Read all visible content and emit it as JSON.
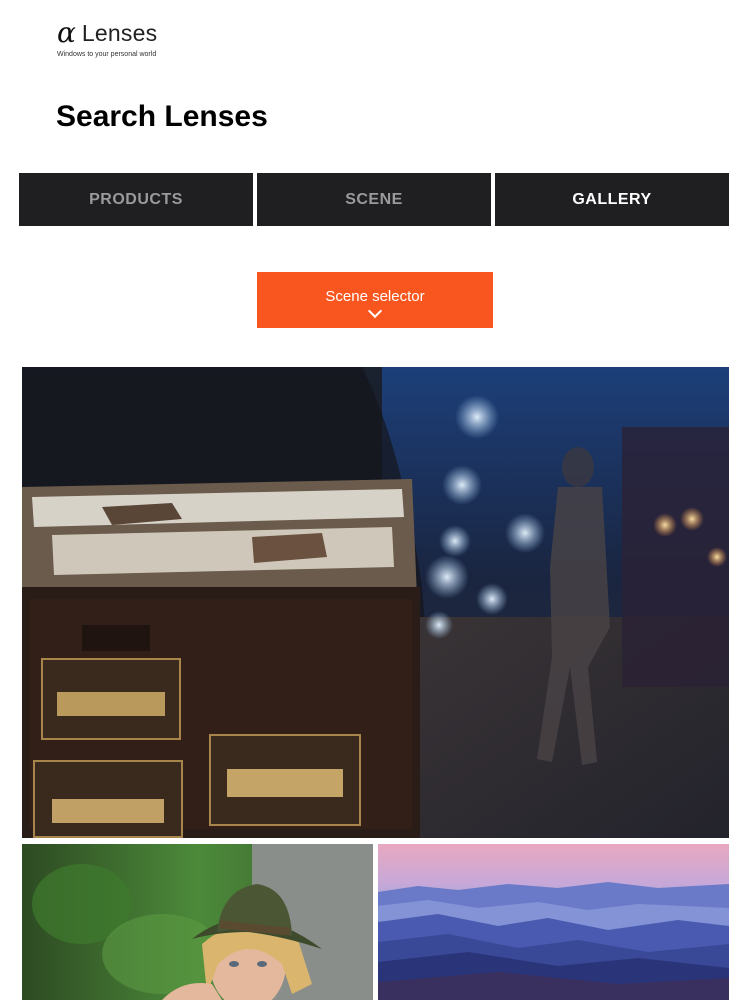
{
  "brand": {
    "logo_symbol": "α",
    "logo_text": "Lenses",
    "tagline": "Windows to your personal world"
  },
  "page": {
    "title": "Search Lenses"
  },
  "tabs": [
    {
      "label": "PRODUCTS",
      "active": false
    },
    {
      "label": "SCENE",
      "active": false
    },
    {
      "label": "GALLERY",
      "active": true
    }
  ],
  "scene_selector": {
    "label": "Scene selector",
    "icon": "chevron-down-icon",
    "color": "#f9561f"
  },
  "gallery": {
    "photos": [
      {
        "subject": "night street with vintage nameplates and bokeh lights"
      },
      {
        "subject": "portrait of woman in green hat"
      },
      {
        "subject": "misty blue mountain ranges at dusk"
      }
    ]
  },
  "colors": {
    "tab_background": "#1f1e21",
    "tab_text": "#9a9a9c",
    "tab_active_text": "#ffffff",
    "accent": "#f9561f"
  }
}
